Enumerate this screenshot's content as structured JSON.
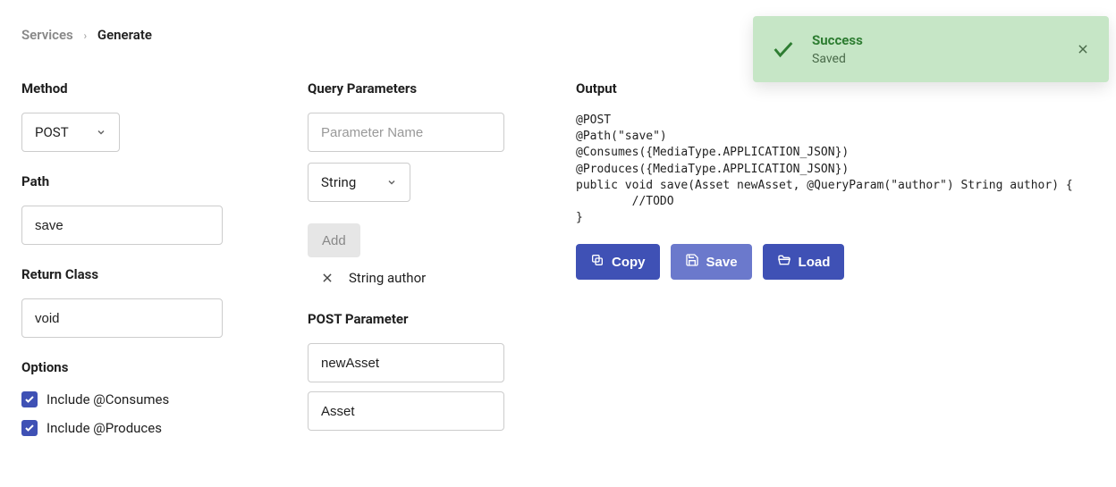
{
  "breadcrumb": {
    "root": "Services",
    "current": "Generate"
  },
  "col1": {
    "method_label": "Method",
    "method_value": "POST",
    "path_label": "Path",
    "path_value": "save",
    "return_class_label": "Return Class",
    "return_class_value": "void",
    "options_label": "Options",
    "include_consumes_label": "Include @Consumes",
    "include_produces_label": "Include @Produces"
  },
  "col2": {
    "query_params_label": "Query Parameters",
    "param_name_placeholder": "Parameter Name",
    "param_type_value": "String",
    "add_label": "Add",
    "params": [
      {
        "display": "String author"
      }
    ],
    "post_param_label": "POST Parameter",
    "post_param_name": "newAsset",
    "post_param_type": "Asset"
  },
  "col3": {
    "output_label": "Output",
    "code": "@POST\n@Path(\"save\")\n@Consumes({MediaType.APPLICATION_JSON})\n@Produces({MediaType.APPLICATION_JSON})\npublic void save(Asset newAsset, @QueryParam(\"author\") String author) {\n        //TODO\n}",
    "copy_label": "Copy",
    "save_label": "Save",
    "load_label": "Load"
  },
  "toast": {
    "title": "Success",
    "body": "Saved"
  }
}
